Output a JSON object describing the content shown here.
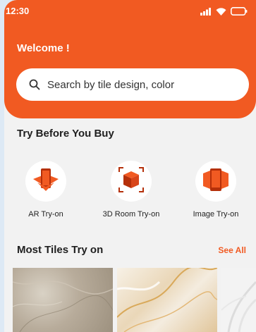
{
  "status_bar": {
    "time": "12:30"
  },
  "header": {
    "welcome": "Welcome !",
    "search_placeholder": "Search by tile design, color"
  },
  "try_section": {
    "title": "Try Before You Buy",
    "options": [
      {
        "label": "AR Try-on",
        "icon": "ar-phone-icon"
      },
      {
        "label": "3D Room Try-on",
        "icon": "3d-cube-icon"
      },
      {
        "label": "Image Try-on",
        "icon": "image-phone-icon"
      }
    ]
  },
  "most_tiles": {
    "title": "Most Tiles Try on",
    "see_all": "See All"
  },
  "colors": {
    "brand": "#f15a22",
    "icon_dark": "#b5300a",
    "background": "#f2f2f2"
  }
}
